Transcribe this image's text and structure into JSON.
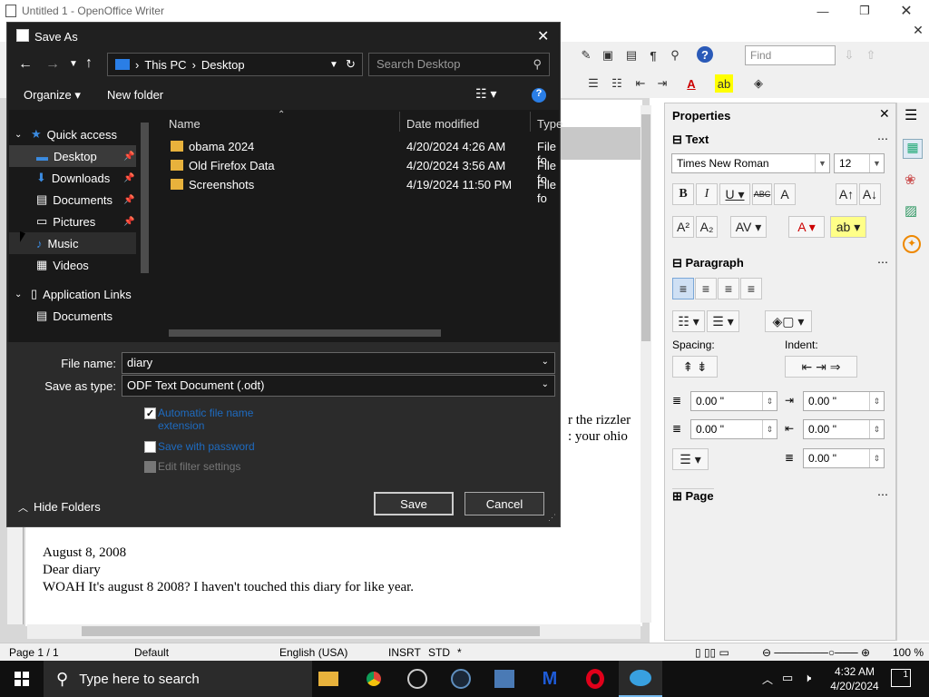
{
  "writer": {
    "title": "Untitled 1 - OpenOffice Writer",
    "find_placeholder": "Find",
    "document_lines": [
      "August 8, 2008",
      "Dear diary",
      "WOAH It's august 8 2008? I haven't touched this diary for like year."
    ],
    "partial_text_right_1": "r the rizzler",
    "partial_text_right_2": ": your ohio"
  },
  "sidebar": {
    "title": "Properties",
    "text_section": "Text",
    "font_name": "Times New Roman",
    "font_size": "12",
    "paragraph_section": "Paragraph",
    "spacing_label": "Spacing:",
    "indent_label": "Indent:",
    "spacing_above": "0.00 \"",
    "spacing_below": "0.00 \"",
    "indent_before": "0.00 \"",
    "indent_after": "0.00 \"",
    "first_line": "0.00 \"",
    "page_section": "Page"
  },
  "statusbar": {
    "page": "Page 1 / 1",
    "style": "Default",
    "language": "English (USA)",
    "insert_mode": "INSRT",
    "selection_mode": "STD",
    "modified": "*",
    "zoom": "100 %"
  },
  "dialog": {
    "title": "Save As",
    "breadcrumb": [
      "This PC",
      "Desktop"
    ],
    "search_placeholder": "Search Desktop",
    "organize_label": "Organize",
    "new_folder_label": "New folder",
    "nav": [
      {
        "label": "Quick access"
      },
      {
        "label": "Desktop"
      },
      {
        "label": "Downloads"
      },
      {
        "label": "Documents"
      },
      {
        "label": "Pictures"
      },
      {
        "label": "Music"
      },
      {
        "label": "Videos"
      },
      {
        "label": "Application Links"
      },
      {
        "label": "Documents"
      }
    ],
    "columns": {
      "name": "Name",
      "date": "Date modified",
      "type": "Type"
    },
    "files": [
      {
        "name": "obama 2024",
        "date": "4/20/2024 4:26 AM",
        "type": "File fo"
      },
      {
        "name": "Old Firefox Data",
        "date": "4/20/2024 3:56 AM",
        "type": "File fo"
      },
      {
        "name": "Screenshots",
        "date": "4/19/2024 11:50 PM",
        "type": "File fo"
      }
    ],
    "filename_label": "File name:",
    "filename_value": "diary",
    "savetype_label": "Save as type:",
    "savetype_value": "ODF Text Document (.odt)",
    "opt_auto_ext_1": "Automatic file name",
    "opt_auto_ext_2": "extension",
    "opt_password": "Save with password",
    "opt_filter": "Edit filter settings",
    "hide_folders": "Hide Folders",
    "save": "Save",
    "cancel": "Cancel"
  },
  "taskbar": {
    "search_placeholder": "Type here to search",
    "time": "4:32 AM",
    "date": "4/20/2024",
    "notification_count": "1"
  }
}
